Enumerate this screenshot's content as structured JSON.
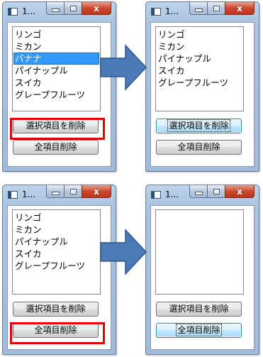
{
  "panels": [
    {
      "title": "1...",
      "items": [
        "リンゴ",
        "ミカン",
        "バナナ",
        "パイナップル",
        "スイカ",
        "グレープフルーツ"
      ],
      "selected_index": 2,
      "delete_selected_label": "選択項目を削除",
      "delete_all_label": "全項目削除",
      "highlighted_button": "delete-selected"
    },
    {
      "title": "1...",
      "items": [
        "リンゴ",
        "ミカン",
        "パイナップル",
        "スイカ",
        "グレープフルーツ"
      ],
      "selected_index": -1,
      "delete_selected_label": "選択項目を削除",
      "delete_all_label": "全項目削除",
      "hot_button": "delete-selected"
    },
    {
      "title": "1...",
      "items": [
        "リンゴ",
        "ミカン",
        "パイナップル",
        "スイカ",
        "グレープフルーツ"
      ],
      "selected_index": -1,
      "delete_selected_label": "選択項目を削除",
      "delete_all_label": "全項目削除",
      "highlighted_button": "delete-all"
    },
    {
      "title": "1...",
      "items": [],
      "selected_index": -1,
      "delete_selected_label": "選択項目を削除",
      "delete_all_label": "全項目削除",
      "hot_button": "delete-all"
    }
  ],
  "colors": {
    "highlight_frame": "#e00000",
    "arrow_fill": "#4a7ab8",
    "selection": "#3399ff"
  },
  "icons": {
    "minimize": "minimize-icon",
    "maximize": "maximize-icon",
    "close": "close-icon",
    "flow_arrow": "right-arrow-icon"
  }
}
